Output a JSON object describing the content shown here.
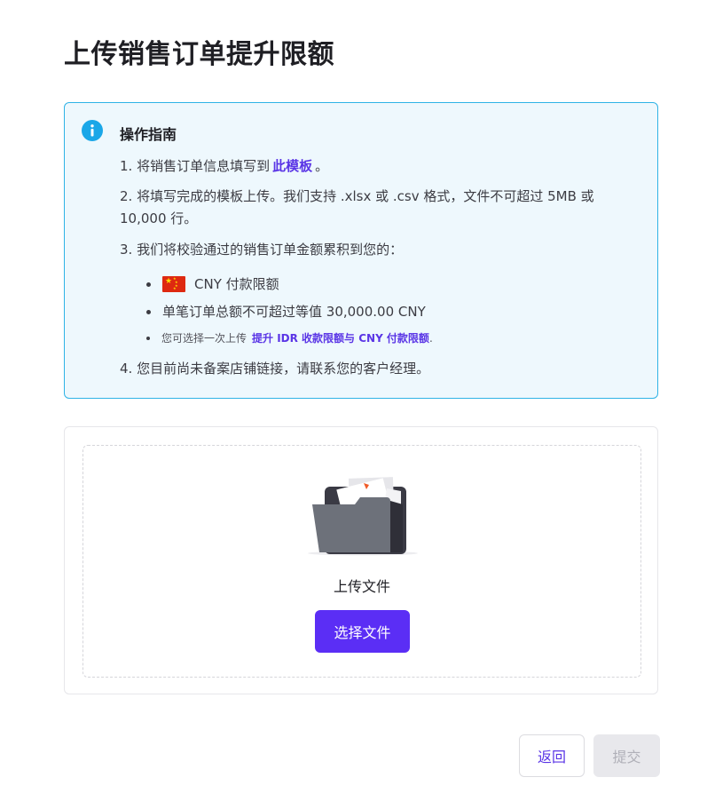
{
  "page": {
    "title": "上传销售订单提升限额"
  },
  "guide": {
    "title": "操作指南",
    "step1_prefix": "1. 将销售订单信息填写到",
    "step1_link": "此模板",
    "step1_suffix": "。",
    "step2": "2. 将填写完成的模板上传。我们支持 .xlsx 或 .csv 格式，文件不可超过 5MB 或 10,000 行。",
    "step3": "3. 我们将校验通过的销售订单金额累积到您的：",
    "sub_items": {
      "limit": "CNY 付款限额",
      "max_order": "单笔订单总额不可超过等值 30,000.00 CNY",
      "hint_prefix": "您可选择一次上传",
      "hint_link": "提升 IDR 收款限额与 CNY 付款限额",
      "hint_suffix": "."
    },
    "step4": "4. 您目前尚未备案店铺链接，请联系您的客户经理。"
  },
  "upload": {
    "label": "上传文件",
    "button": "选择文件"
  },
  "footer": {
    "back": "返回",
    "submit": "提交"
  },
  "colors": {
    "accent": "#5b2ef5",
    "link": "#5a35e6",
    "info_bg": "#eef8fd",
    "info_border": "#2fb3e6"
  },
  "icons": {
    "info": "info-circle-icon",
    "flag": "china-flag-icon",
    "folder": "folder-illustration"
  }
}
